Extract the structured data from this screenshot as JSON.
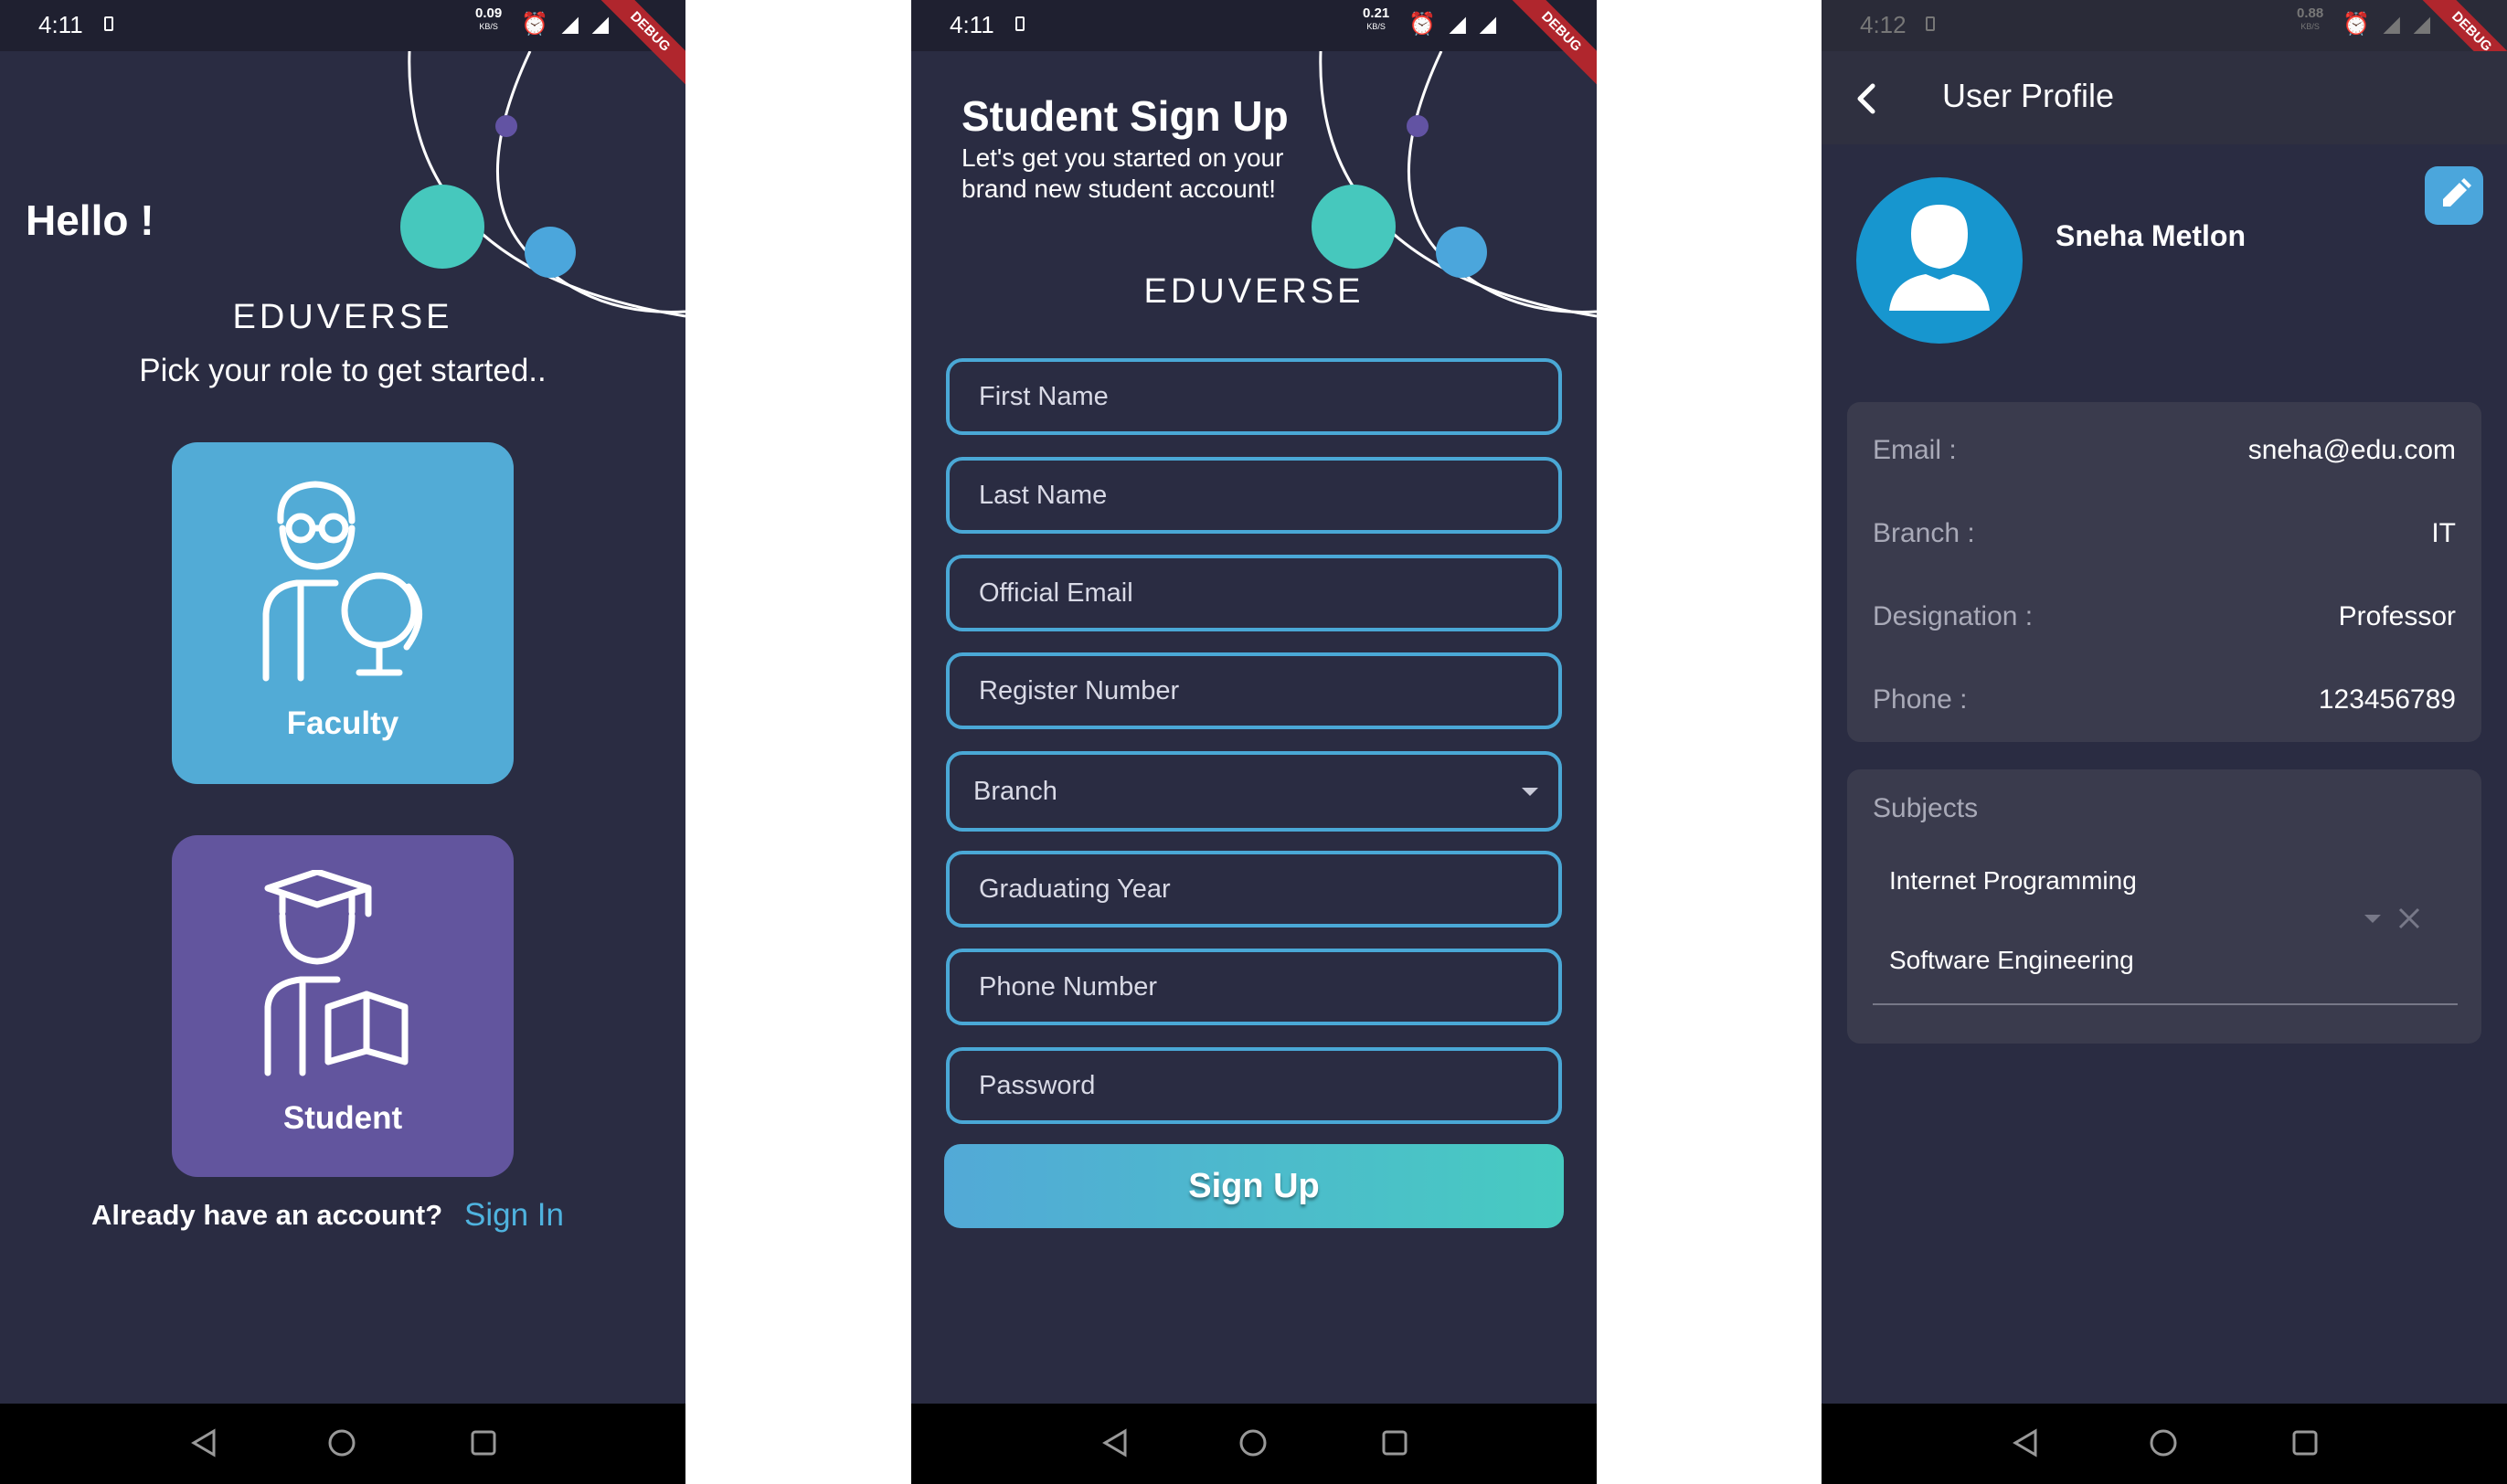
{
  "screen1": {
    "status": {
      "time": "4:11",
      "speed": "0.09",
      "speed_unit": "KB/S",
      "icons": "⏰ ◢ ◢",
      "debug": "DEBUG"
    },
    "greeting": "Hello !",
    "brand": "EDUVERSE",
    "prompt": "Pick your role to get started..",
    "roles": [
      {
        "label": "Faculty",
        "color": "#52abd6",
        "icon": "faculty-icon"
      },
      {
        "label": "Student",
        "color": "#62559e",
        "icon": "student-icon"
      }
    ],
    "footer": {
      "question": "Already have an account?",
      "link": "Sign In"
    }
  },
  "screen2": {
    "status": {
      "time": "4:11",
      "speed": "0.21",
      "speed_unit": "KB/S",
      "icons": "⏰ ◢ ◢",
      "debug": "DEBUG"
    },
    "title": "Student Sign Up",
    "subtitle": "Let's get you started on your brand new student account!",
    "brand": "EDUVERSE",
    "fields": [
      "First Name",
      "Last Name",
      "Official Email",
      "Register Number",
      "Branch",
      "Graduating Year",
      "Phone Number",
      "Password"
    ],
    "submit": "Sign Up",
    "accent": "#4aa8d6"
  },
  "screen3": {
    "status": {
      "time": "4:12",
      "speed": "0.88",
      "speed_unit": "KB/S",
      "icons": "⏰ ◢ ◢",
      "debug": "DEBUG"
    },
    "appbar_title": "User Profile",
    "name": "Sneha Metlon",
    "details": [
      {
        "key": "Email :",
        "value": "sneha@edu.com"
      },
      {
        "key": "Branch :",
        "value": "IT"
      },
      {
        "key": "Designation :",
        "value": "Professor"
      },
      {
        "key": "Phone :",
        "value": "123456789"
      }
    ],
    "subjects_label": "Subjects",
    "subjects": [
      "Internet Programming",
      "Software Engineering"
    ]
  }
}
